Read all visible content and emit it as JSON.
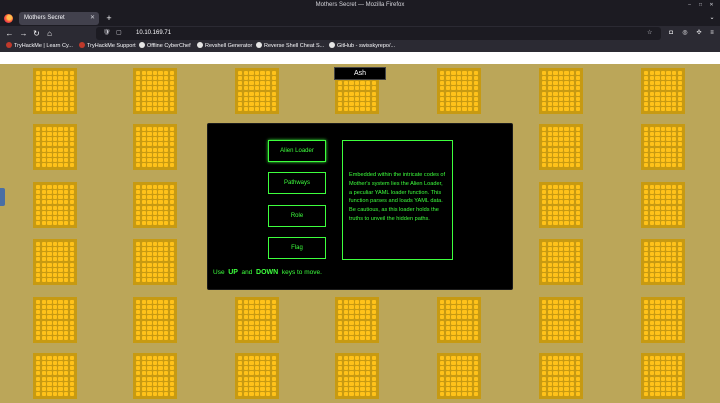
{
  "window": {
    "title": "Mothers Secret — Mozilla Firefox"
  },
  "tab": {
    "title": "Mothers Secret"
  },
  "address_bar": {
    "url": "10.10.169.71"
  },
  "bookmarks": [
    {
      "label": "TryHackMe | Learn Cy...",
      "color": "#c0392b"
    },
    {
      "label": "TryHackMe Support",
      "color": "#c0392b"
    },
    {
      "label": "Offline CyberChef",
      "color": "#e6e6e6"
    },
    {
      "label": "Revshell Generator",
      "color": "#e6e6e6"
    },
    {
      "label": "Reverse Shell Cheat S...",
      "color": "#e6e6e6"
    },
    {
      "label": "GitHub - swisskyrepo/...",
      "color": "#e6e6e6"
    }
  ],
  "page": {
    "name_label": "Ash",
    "menu": [
      {
        "label": "Alien Loader",
        "selected": true
      },
      {
        "label": "Pathways",
        "selected": false
      },
      {
        "label": "Role",
        "selected": false
      },
      {
        "label": "Flag",
        "selected": false
      }
    ],
    "description": "Embedded within the intricate codes of Mother's system lies the Alien Loader, a peculiar YAML loader function. This function parses and loads YAML data. Be cautious, as this loader holds the truths to unveil the hidden paths.",
    "hint": {
      "prefix": "Use",
      "key_up": "UP",
      "and": "and",
      "key_down": "DOWN",
      "suffix": "keys to move."
    }
  },
  "colors": {
    "terminal_green": "#3dff3d",
    "background": "#bba659",
    "panel": "#c79a12",
    "panel_cell": "#ffc21a"
  }
}
